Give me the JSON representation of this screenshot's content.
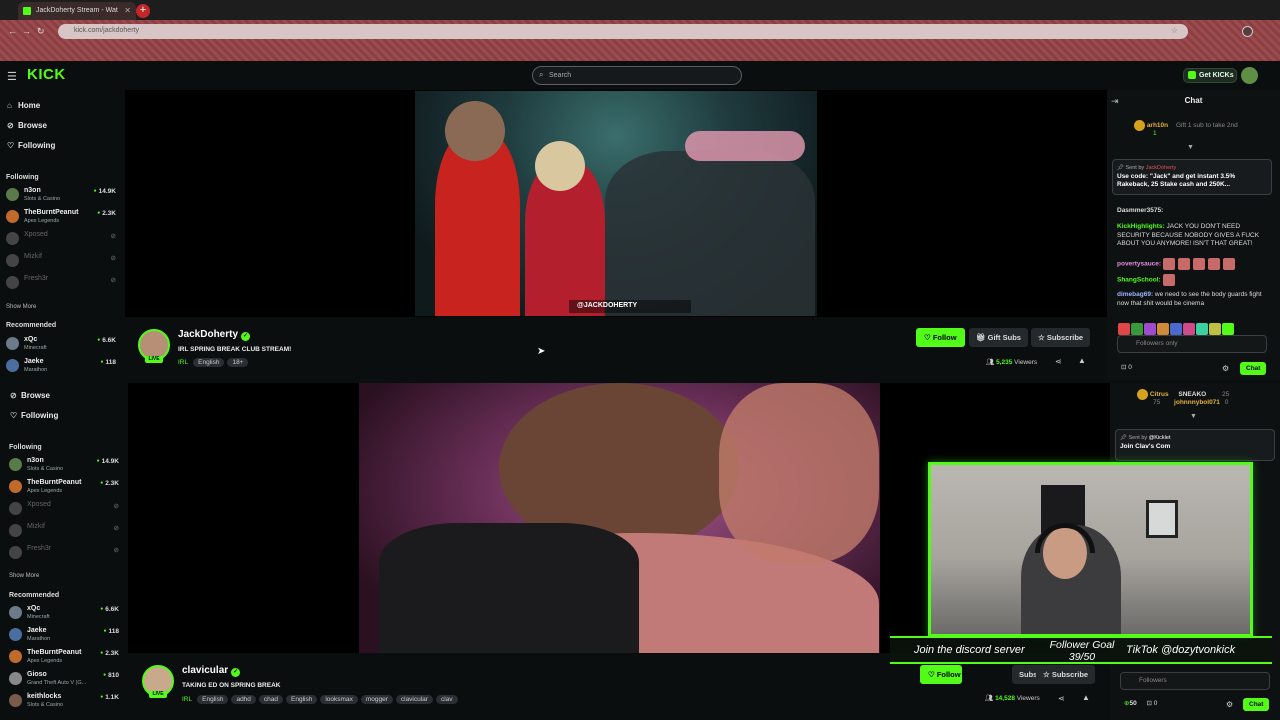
{
  "browser": {
    "tab_title": "JackDoherty Stream - Wat",
    "new_tab": "+",
    "url": "kick.com/jackdoherty"
  },
  "header": {
    "logo": "KICK",
    "search_placeholder": "Search",
    "get_kicks": "Get KICKs"
  },
  "sidebar": {
    "nav": [
      {
        "label": "Home",
        "icon": "home-icon"
      },
      {
        "label": "Browse",
        "icon": "compass-icon"
      },
      {
        "label": "Following",
        "icon": "heart-icon"
      }
    ],
    "nav2": [
      {
        "label": "Browse",
        "icon": "compass-icon"
      },
      {
        "label": "Following",
        "icon": "heart-icon"
      }
    ],
    "following_title": "Following",
    "following": [
      {
        "name": "n3on",
        "category": "Slots & Casino",
        "viewers": "14.9K",
        "online": true,
        "color": "#5b7a4a"
      },
      {
        "name": "TheBurntPeanut",
        "category": "Apex Legends",
        "viewers": "2.3K",
        "online": true,
        "color": "#c06a2b"
      },
      {
        "name": "Xposed",
        "category": "",
        "viewers": "",
        "online": false,
        "color": "#444"
      },
      {
        "name": "Mizkif",
        "category": "",
        "viewers": "",
        "online": false,
        "color": "#444"
      },
      {
        "name": "Fresh3r",
        "category": "",
        "viewers": "",
        "online": false,
        "color": "#444"
      }
    ],
    "show_more": "Show More",
    "recommended_title": "Recommended",
    "recommended": [
      {
        "name": "xQc",
        "category": "Minecraft",
        "viewers": "6.6K",
        "color": "#6d7a8a"
      },
      {
        "name": "Jaeke",
        "category": "Marathon",
        "viewers": "118",
        "color": "#4a6ea0"
      }
    ],
    "recommended2": [
      {
        "name": "xQc",
        "category": "Minecraft",
        "viewers": "6.6K",
        "color": "#6d7a8a"
      },
      {
        "name": "Jaeke",
        "category": "Marathon",
        "viewers": "118",
        "color": "#4a6ea0"
      },
      {
        "name": "TheBurntPeanut",
        "category": "Apex Legends",
        "viewers": "2.3K",
        "color": "#c06a2b"
      },
      {
        "name": "Gioso",
        "category": "Grand Theft Auto V (G...",
        "viewers": "810",
        "color": "#888"
      },
      {
        "name": "keithlocks",
        "category": "Slots & Casino",
        "viewers": "1.1K",
        "color": "#7a5a4a"
      }
    ]
  },
  "stream1": {
    "streamer": "JackDoherty",
    "title": "IRL SPRING BREAK CLUB STREAM!",
    "category": "IRL",
    "tags": [
      "English",
      "18+"
    ],
    "watermark": "@JACKDOHERTY",
    "follow": "Follow",
    "gift_subs": "Gift Subs",
    "subscribe": "Subscribe",
    "viewers": "5,235",
    "viewers_label": "Viewers",
    "live": "LIVE"
  },
  "stream2": {
    "streamer": "clavicular",
    "title": "TAKING ED ON SPRING BREAK",
    "category": "IRL",
    "tags": [
      "English",
      "adhd",
      "chad",
      "English",
      "looksmax",
      "mogger",
      "clavicular",
      "clav"
    ],
    "follow": "Follow",
    "subs": "Subs",
    "subscribe": "Subscribe",
    "viewers": "14,528",
    "viewers_label": "Viewers",
    "live": "LIVE"
  },
  "chat1": {
    "title": "Chat",
    "gifter": {
      "user": "arh10n",
      "count": "1",
      "text": "Gift 1 sub to take 2nd"
    },
    "pinned": {
      "sent_by": "Sent by",
      "author": "JackDoherty",
      "text": "Use code: \"Jack\" and get instant 3.5% Rakeback, 25 Stake cash and 250K..."
    },
    "messages": [
      {
        "user": "Dasmmer3575:",
        "text": "",
        "color": "#ddd"
      },
      {
        "user": "KickHighlights:",
        "text": " JACK YOU DON'T NEED SECURITY BECAUSE NOBODY GIVES A FUCK ABOUT YOU ANYMORE! ISN'T THAT GREAT!",
        "color": "#53fc18"
      },
      {
        "user": "povertysauce:",
        "text": "",
        "color": "#e88de0"
      },
      {
        "user": "ShangSchool:",
        "text": "",
        "color": "#53fc18"
      },
      {
        "user": "dimebag69:",
        "text": " we need to see the body guards fight now that shit would be cinema",
        "color": "#9bb5ff"
      }
    ],
    "input_placeholder": "Followers only",
    "points": "0",
    "send": "Chat"
  },
  "chat2": {
    "gifters": [
      {
        "user": "Citrus",
        "count": "75"
      },
      {
        "user": "SNEAKO",
        "count": "25"
      },
      {
        "user": "johnnnybol071",
        "count": "0"
      }
    ],
    "pinned": {
      "sent_by": "Sent by",
      "author": "@Kicklet",
      "text": "Join Clav's Com"
    },
    "input_placeholder": "Followers",
    "points_a": "50",
    "points_b": "0",
    "send": "Chat"
  },
  "overlay": {
    "discord": "Join the discord server",
    "goal_label": "Follower Goal",
    "goal_value": "39/50",
    "tiktok": "TikTok @dozytvonkick"
  }
}
